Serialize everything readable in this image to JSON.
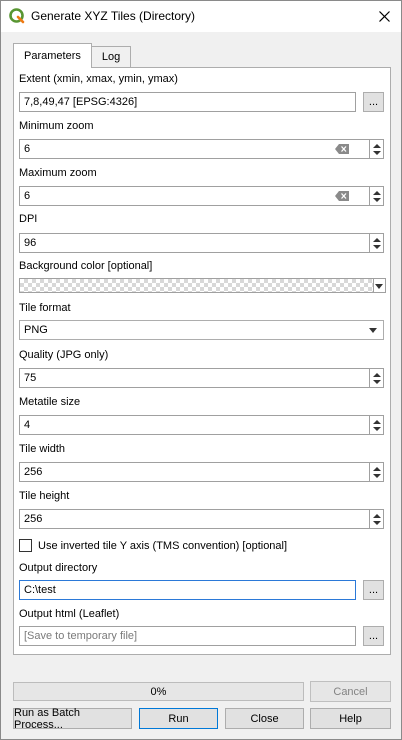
{
  "window": {
    "title": "Generate XYZ Tiles (Directory)"
  },
  "tabs": [
    {
      "label": "Parameters"
    },
    {
      "label": "Log"
    }
  ],
  "params": {
    "extent": {
      "label": "Extent (xmin, xmax, ymin, ymax)",
      "value": "7,8,49,47 [EPSG:4326]",
      "button": "..."
    },
    "min_zoom": {
      "label": "Minimum zoom",
      "value": "6"
    },
    "max_zoom": {
      "label": "Maximum zoom",
      "value": "6"
    },
    "dpi": {
      "label": "DPI",
      "value": "96"
    },
    "bg_color": {
      "label": "Background color [optional]"
    },
    "tile_format": {
      "label": "Tile format",
      "value": "PNG"
    },
    "quality": {
      "label": "Quality (JPG only)",
      "value": "75"
    },
    "metatile": {
      "label": "Metatile size",
      "value": "4"
    },
    "tile_width": {
      "label": "Tile width",
      "value": "256"
    },
    "tile_height": {
      "label": "Tile height",
      "value": "256"
    },
    "tms": {
      "label": "Use inverted tile Y axis (TMS convention) [optional]",
      "checked": false
    },
    "output_dir": {
      "label": "Output directory",
      "value": "C:\\test",
      "button": "..."
    },
    "output_html": {
      "label": "Output html (Leaflet)",
      "placeholder": "[Save to temporary file]",
      "button": "..."
    }
  },
  "progress": {
    "text": "0%",
    "value": 0
  },
  "buttons": {
    "cancel": "Cancel",
    "batch": "Run as Batch Process...",
    "run": "Run",
    "close": "Close",
    "help": "Help"
  },
  "icons": {
    "app": "qgis-logo-icon",
    "close": "close-icon",
    "clear": "clear-icon",
    "spin": "spinner-arrows-icon",
    "dropdown": "chevron-down-icon"
  },
  "colors": {
    "qgis_green": "#589632",
    "qgis_yellow": "#ee7913",
    "focus_border": "#2b79d8",
    "default_button_border": "#0078d7"
  }
}
